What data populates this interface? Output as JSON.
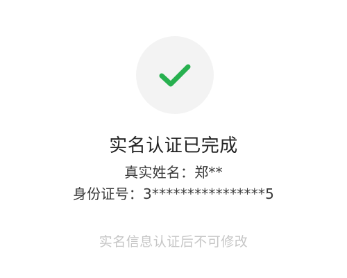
{
  "icon": {
    "name": "check-icon",
    "color": "#27b04f",
    "background": "#f3f3f3"
  },
  "verification": {
    "title": "实名认证已完成",
    "name_label": "真实姓名：",
    "name_value": "郑**",
    "id_label": "身份证号：",
    "id_value": "3****************5",
    "note": "实名信息认证后不可修改"
  }
}
